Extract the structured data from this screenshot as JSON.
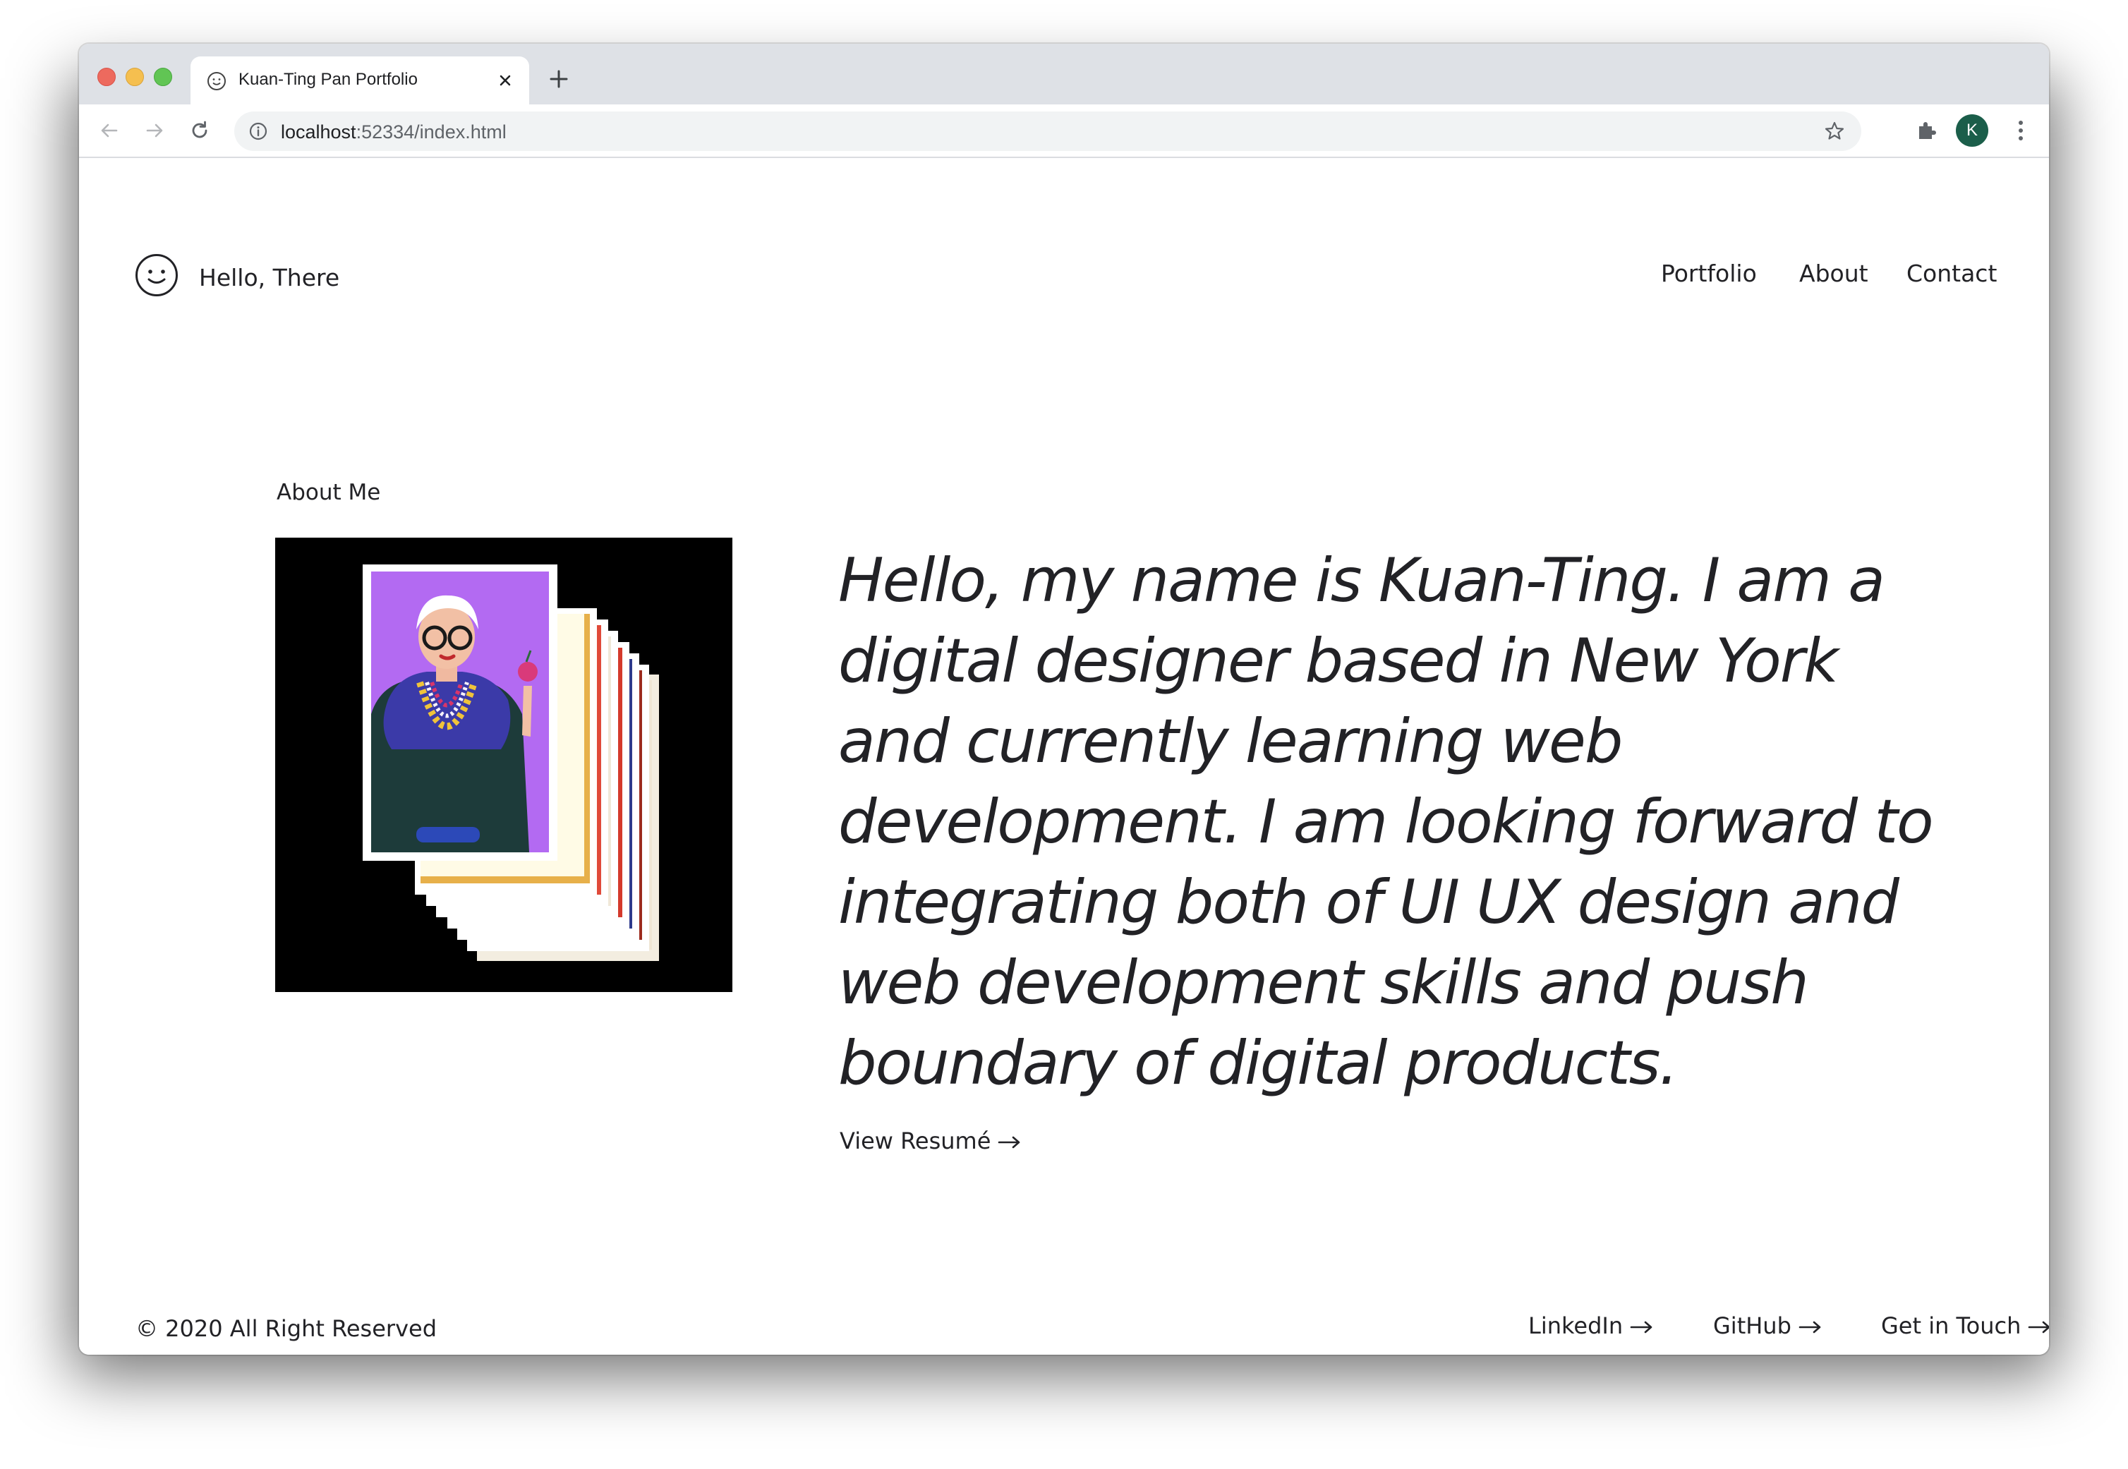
{
  "browser": {
    "tab_title": "Kuan-Ting Pan Portfolio",
    "url_host": "localhost",
    "url_rest": ":52334/index.html",
    "avatar_letter": "K"
  },
  "header": {
    "logo_text": "Hello, There",
    "nav": [
      "Portfolio",
      "About",
      "Contact"
    ]
  },
  "about": {
    "label": "About Me",
    "intro": "Hello, my name is Kuan-Ting. I am a digital designer based in New York and currently learning web development. I am looking forward to integrating both of UI UX design and web development skills and push boundary of digital products.",
    "resume_link": "View Resumé"
  },
  "footer": {
    "copyright": "© 2020 All Right Reserved",
    "links": [
      "LinkedIn",
      "GitHub",
      "Get in Touch"
    ]
  },
  "colors": {
    "text": "#222226",
    "image_bg": "#000000",
    "portrait_bg": "#b36af2",
    "avatar_bg": "#1b5e4a",
    "card_strips": [
      "#e7b04a",
      "#e04a3a",
      "#f0e8d8",
      "#d43a2c",
      "#2d3a8c",
      "#9c2b1e",
      "#efe6d4"
    ]
  },
  "icons": {
    "logo": "smiley-face-icon",
    "arrow": "right-arrow-icon"
  }
}
